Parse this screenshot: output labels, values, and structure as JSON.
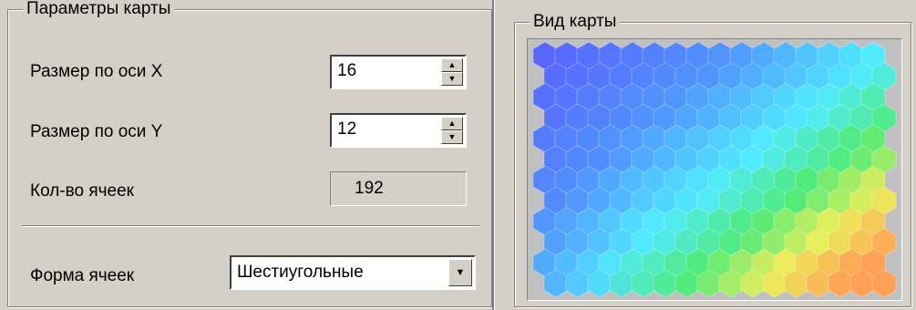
{
  "params": {
    "title": "Параметры карты",
    "size_x_label": "Размер по оси X",
    "size_x_value": "16",
    "size_y_label": "Размер по оси Y",
    "size_y_value": "12",
    "cell_count_label": "Кол-во ячеек",
    "cell_count_value": "192",
    "cell_shape_label": "Форма ячеек",
    "cell_shape_value": "Шестиугольные"
  },
  "map_view": {
    "title": "Вид карты",
    "grid_columns": 16,
    "grid_rows": 12,
    "cell_shape": "hexagon",
    "gradient_colors": {
      "top_left": "#5a6bff",
      "top_right": "#5aa8ff",
      "center": "#4ee8ff",
      "bottom_left": "#5577ff",
      "bottom_right": "#ff9a55",
      "lower_right_mid": "#55ee66",
      "lower_right_yellow": "#eeee55"
    }
  }
}
